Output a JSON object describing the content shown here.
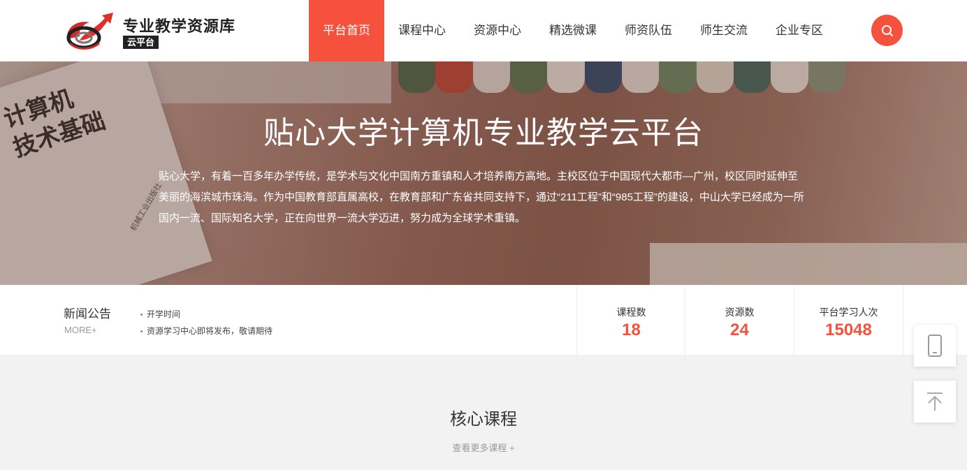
{
  "header": {
    "logo_title": "专业教学资源库",
    "logo_badge": "云平台",
    "nav": [
      "平台首页",
      "课程中心",
      "资源中心",
      "精选微课",
      "师资队伍",
      "师生交流",
      "企业专区"
    ]
  },
  "banner": {
    "title": "贴心大学计算机专业教学云平台",
    "description": "贴心大学，有着一百多年办学传统，是学术与文化中国南方重镇和人才培养南方高地。主校区位于中国现代大都市—广州，校区同时延伸至美丽的海滨城市珠海。作为中国教育部直属高校，在教育部和广东省共同支持下，通过“211工程”和“985工程”的建设，中山大学已经成为一所国内一流、国际知名大学，正在向世界一流大学迈进，努力成为全球学术重镇。",
    "book_text_line1": "计算机",
    "book_text_line2": "技术基础",
    "book_publisher": "机械工业出版社"
  },
  "news": {
    "title": "新闻公告",
    "more": "MORE+",
    "items": [
      "开学时间",
      "资源学习中心即将发布，敬请期待"
    ]
  },
  "stats": [
    {
      "label": "课程数",
      "value": "18"
    },
    {
      "label": "资源数",
      "value": "24"
    },
    {
      "label": "平台学习人次",
      "value": "15048"
    }
  ],
  "core_courses": {
    "title": "核心课程",
    "more": "查看更多课程 +"
  },
  "colors": {
    "accent": "#f5513c"
  }
}
